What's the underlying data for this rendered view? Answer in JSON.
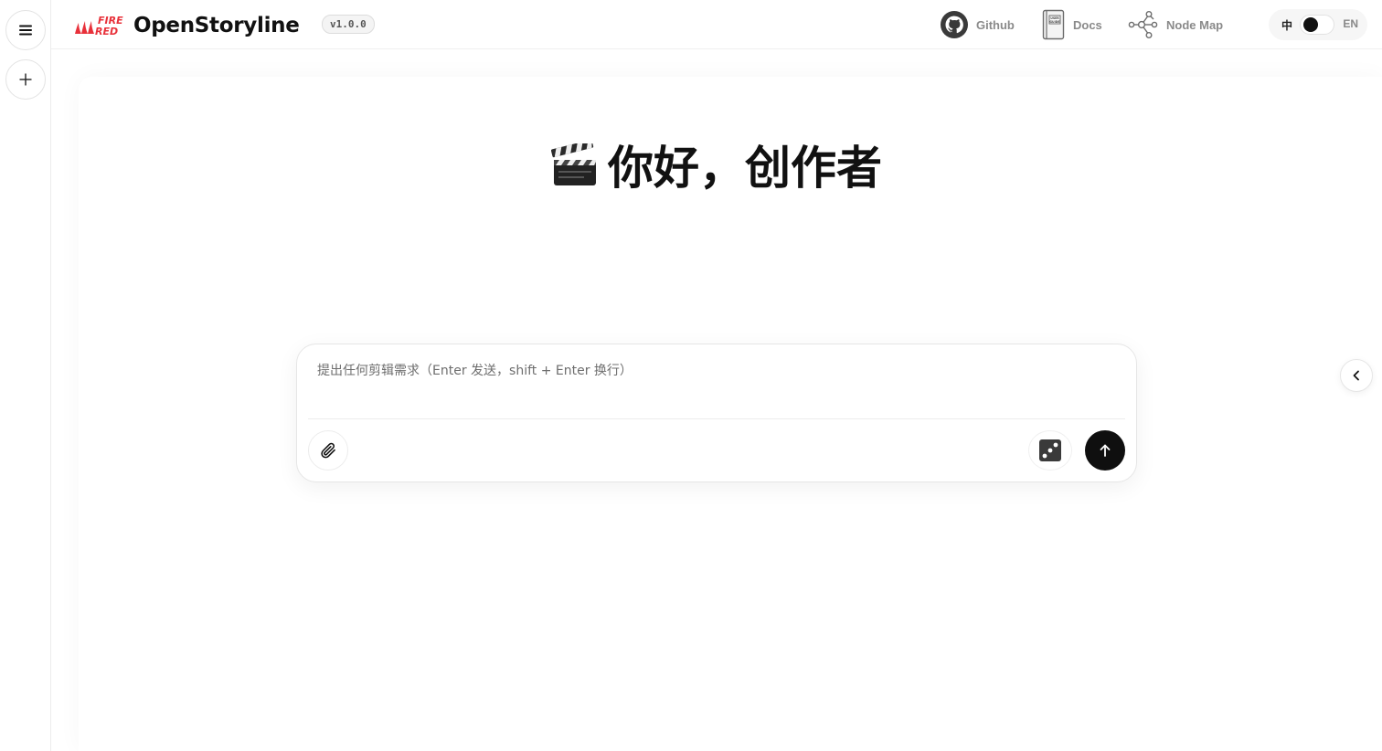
{
  "header": {
    "logo_brand": "FIRE RED",
    "app_name": "OpenStoryline",
    "version": "v1.0.0",
    "nav": [
      {
        "label": "Github",
        "icon": "github-icon"
      },
      {
        "label": "Docs",
        "icon": "user-guide-book-icon"
      },
      {
        "label": "Node Map",
        "icon": "node-graph-icon"
      }
    ],
    "language": {
      "left": "中",
      "right": "EN",
      "selected": "中"
    }
  },
  "sidebar": {
    "menu_icon": "hamburger-menu-icon",
    "new_icon": "plus-icon"
  },
  "main": {
    "greeting": "你好，创作者",
    "greeting_icon": "clapperboard-icon"
  },
  "composer": {
    "placeholder": "提出任何剪辑需求（Enter 发送，shift + Enter 换行）",
    "value": "",
    "attach_icon": "paperclip-icon",
    "random_icon": "dice-icon",
    "send_icon": "arrow-up-icon"
  },
  "right_panel": {
    "toggle_icon": "chevron-left-icon"
  }
}
